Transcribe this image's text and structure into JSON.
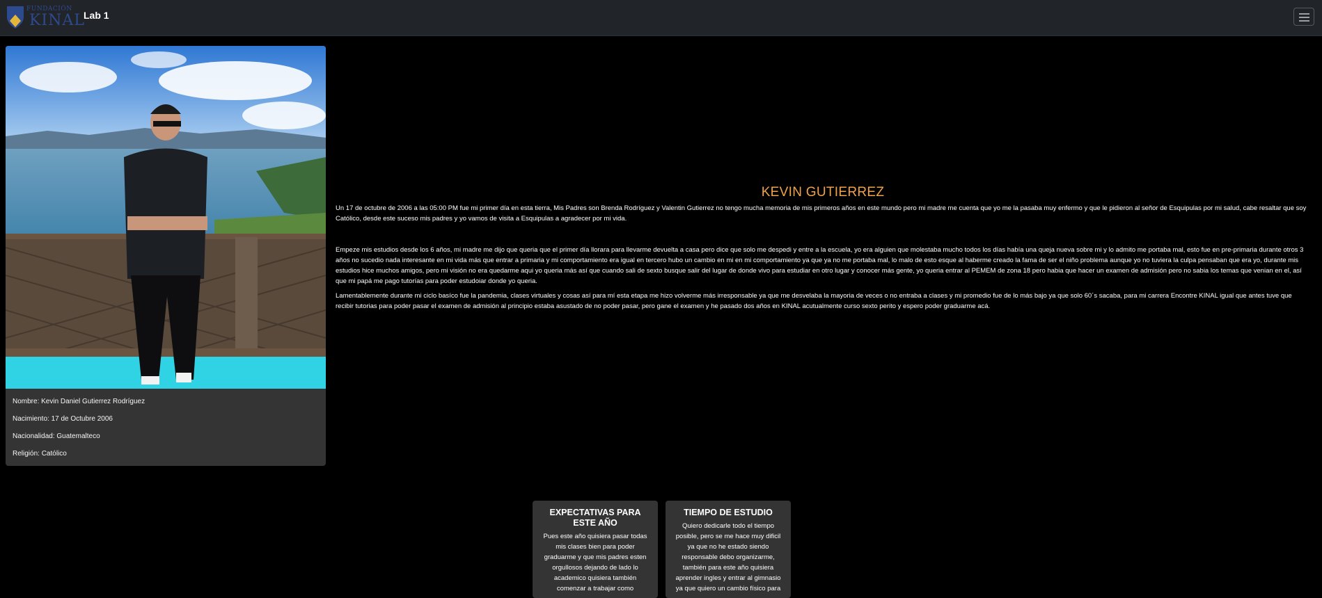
{
  "navbar": {
    "logo_small": "FUNDACIÓN",
    "logo_big": "KINAL",
    "brand": "Lab 1",
    "toggler_icon": "hamburger-menu-icon"
  },
  "profile": {
    "photo_alt": "Kevin Gutierrez",
    "nombre": "Nombre: Kevin Daniel Gutierrez Rodríguez",
    "nacimiento": "Nacimiento: 17 de Octubre 2006",
    "nacionalidad": "Nacionalidad: Guatemalteco",
    "religion": "Religión: Católico"
  },
  "hero": {
    "title": "KEVIN GUTIERREZ",
    "p1": "Un 17 de octubre de 2006 a las 05:00 PM fue mi primer día en esta tierra, Mis Padres son Brenda Rodríguez y Valentin Gutierrez no tengo mucha memoria de mis primeros años en este mundo pero mi madre me cuenta que yo me la pasaba muy enfermo y que le pidieron al señor de Esquipulas por mi salud, cabe resaltar que soy Católico, desde este suceso mis padres y yo vamos de visita a Esquipulas a agradecer por mi vida.",
    "p2": "Empeze mis estudios desde los 6 años, mi madre me dijo que queria que el primer día llorara para llevarme devuelta a casa pero dice que solo me despedi y entre a la escuela, yo era alguien que molestaba mucho todos los días había una queja nueva sobre mi y lo admito me portaba mal, esto fue en pre-primaria durante otros 3 años no sucedio nada interesante en mi vida más que entrar a primaria y mi comportamiento era igual en tercero hubo un cambio en mi en mi comportamiento ya que ya no me portaba mal, lo malo de esto esque al haberme creado la fama de ser el niño problema aunque yo no tuviera la culpa pensaban que era yo, durante mis estudios hice muchos amigos, pero mi visión no era quedarme aqui yo queria más así que cuando sali de sexto busque salir del lugar de donde vivo para estudiar en otro lugar y conocer más gente, yo queria entrar al PEMEM de zona 18 pero habia que hacer un examen de admisión pero no sabia los temas que venian en el, así que mi papá me pago tutorías para poder estudoiar donde yo queria.",
    "p3": "Lamentablemente durante mi ciclo basíco fue la pandemia, clases virtuales y cosas así para mí esta etapa me hizo volverme más irresponsable ya que me desvelaba la mayoria de veces o no entraba a clases y mi promedio fue de lo más bajo ya que solo 60´s sacaba, para mi carrera Encontre KINAL igual que antes tuve que recibir tutorias para poder pasar el examen de admisión al principio estaba asustado de no poder pasar, pero gane el examen y he pasado dos años en KINAL acutualmente curso sexto perito y espero poder graduarme acá."
  },
  "cards": {
    "expectativas_title": "EXPECTATIVAS PARA ESTE AÑO",
    "expectativas_text": "Pues este año quisiera pasar todas mis clases bien para poder graduarme y que mis padres esten orgullosos dejando de lado lo academico quisiera también comenzar a trabajar como",
    "tiempo_title": "TIEMPO DE ESTUDIO",
    "tiempo_text": "Quiero dedicarle todo el tiempo posible, pero se me hace muy dificil ya que no he estado siendo responsable debo organizarme, también para este año quisiera aprender ingles y entrar al gimnasio ya que quiero un cambio físico para"
  },
  "colors": {
    "page_bg": "#000000",
    "navbar_bg": "#212529",
    "card_bg": "#343434",
    "title_accent": "#f0a24a",
    "logo_blue": "#2e4a8e",
    "logo_gold": "#e3b83a"
  }
}
